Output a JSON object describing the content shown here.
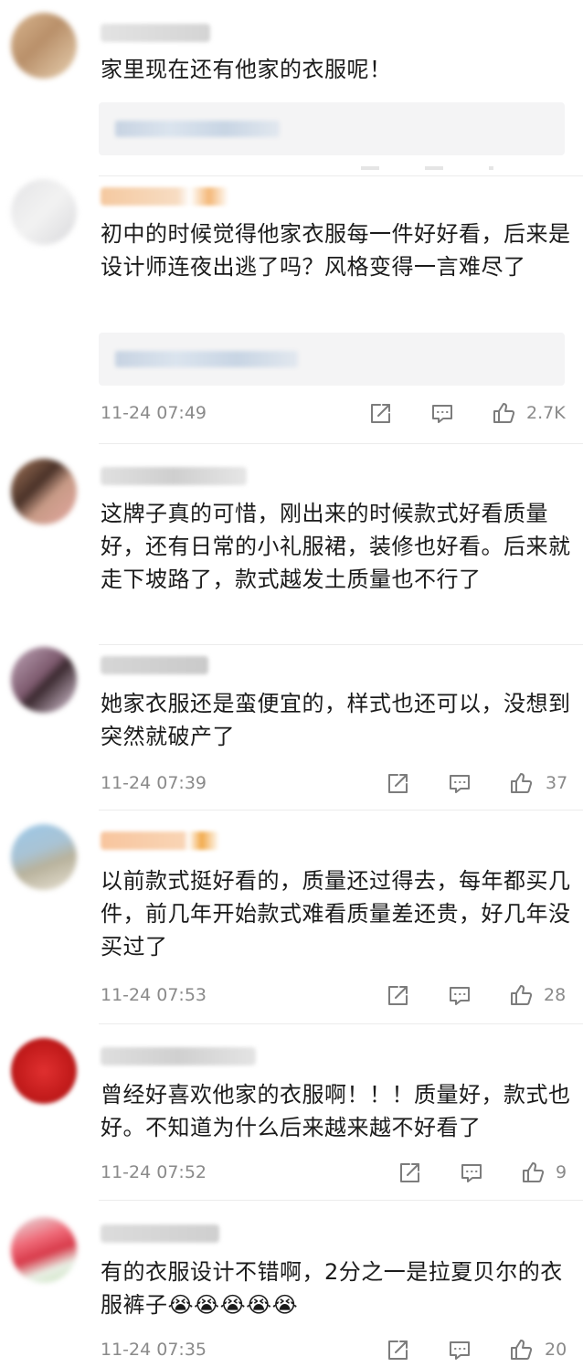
{
  "comments": [
    {
      "text": "家里现在还有他家的衣服呢！"
    },
    {
      "text": "初中的时候觉得他家衣服每一件好好看，后来是设计师连夜出逃了吗？风格变得一言难尽了",
      "time": "11-24 07:49",
      "likes": "2.7K"
    },
    {
      "text": "这牌子真的可惜，刚出来的时候款式好看质量好，还有日常的小礼服裙，装修也好看。后来就走下坡路了，款式越发土质量也不行了"
    },
    {
      "text": "她家衣服还是蛮便宜的，样式也还可以，没想到突然就破产了",
      "time": "11-24 07:39",
      "likes": "37"
    },
    {
      "text": "以前款式挺好看的，质量还过得去，每年都买几件，前几年开始款式难看质量差还贵，好几年没买过了",
      "time": "11-24 07:53",
      "likes": "28"
    },
    {
      "text": "曾经好喜欢他家的衣服啊！！！质量好，款式也好。不知道为什么后来越来越不好看了",
      "time": "11-24 07:52",
      "likes": "9"
    },
    {
      "text": "有的衣服设计不错啊，2分之一是拉夏贝尔的衣服裤子😭😭😭😭😭",
      "time": "11-24 07:35",
      "likes": "20"
    }
  ],
  "colors": {
    "text": "#1b1b1b",
    "meta": "#8a8a8a",
    "quote_bg": "#f4f4f5"
  },
  "icons": {
    "share": "share-icon",
    "comment": "comment-icon",
    "like": "thumbs-up-icon"
  }
}
